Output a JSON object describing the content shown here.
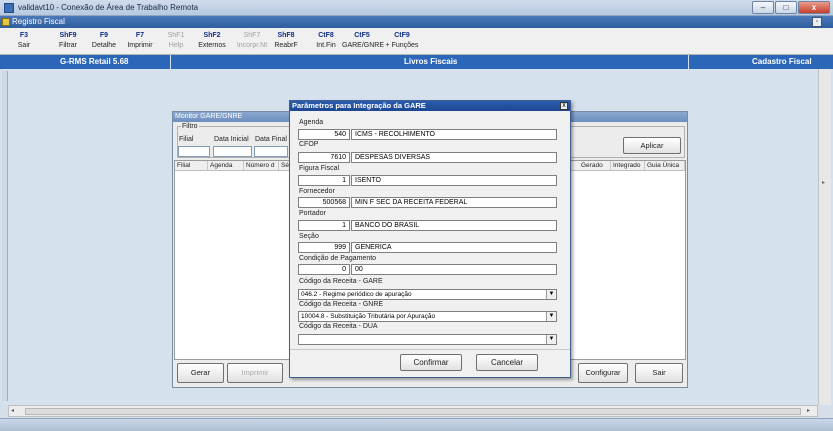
{
  "window": {
    "title": "validavt10 - Conexão de Área de Trabalho Remota"
  },
  "app": {
    "title": "Registro Fiscal"
  },
  "toolbar": [
    {
      "key": "F3",
      "label": "Sair",
      "enabled": true
    },
    {
      "key": "ShF9",
      "label": "Filtrar",
      "enabled": true
    },
    {
      "key": "F9",
      "label": "Detalhe",
      "enabled": true
    },
    {
      "key": "F7",
      "label": "Imprimir",
      "enabled": true
    },
    {
      "key": "ShF1",
      "label": "Help",
      "enabled": false
    },
    {
      "key": "ShF2",
      "label": "Externos",
      "enabled": true
    },
    {
      "key": "ShF7",
      "label": "Incorpr.Nt",
      "enabled": false
    },
    {
      "key": "ShF8",
      "label": "ReabrF",
      "enabled": true
    },
    {
      "key": "CtF8",
      "label": "Int.Fin",
      "enabled": true
    },
    {
      "key": "CtF5",
      "label": "GARE/GNRE",
      "enabled": true
    },
    {
      "key": "CtF9",
      "label": "+ Funções",
      "enabled": true
    }
  ],
  "bluebar": {
    "left": "G-RMS Retail 5.68",
    "center": "Livros Fiscais",
    "right": "Cadastro Fiscal"
  },
  "monitor": {
    "title": "Monitor GARE/GNRE",
    "filter_group": "Filtro",
    "filial_label": "Filial",
    "data_inicial_label": "Data Inicial",
    "data_final_label": "Data Final",
    "apply_button": "Aplicar",
    "columns_left": [
      "Filial",
      "Agenda",
      "Número d",
      "Sér"
    ],
    "columns_right": [
      "Gerado",
      "Integrado",
      "Guia Única"
    ],
    "buttons": {
      "gerar": "Gerar",
      "imprimir": "Imprimir",
      "configurar": "Configurar",
      "sair": "Sair"
    }
  },
  "dialog": {
    "title": "Parâmetros para Integração da GARE",
    "close": "x",
    "fields": {
      "agenda": {
        "label": "Agenda",
        "code": "540",
        "desc": "ICMS - RECOLHIMENTO"
      },
      "cfop": {
        "label": "CFOP",
        "code": "7610",
        "desc": "DESPESAS DIVERSAS"
      },
      "figura": {
        "label": "Figura Fiscal",
        "code": "1",
        "desc": "ISENTO"
      },
      "fornecedor": {
        "label": "Fornecedor",
        "code": "500568",
        "desc": "MIN F SEC DA RECEITA FEDERAL"
      },
      "portador": {
        "label": "Portador",
        "code": "1",
        "desc": "BANCO DO BRASIL"
      },
      "secao": {
        "label": "Seção",
        "code": "999",
        "desc": "GENERICA"
      },
      "condicao": {
        "label": "Condição de Pagamento",
        "code": "0",
        "desc": "00"
      }
    },
    "combos": {
      "gare": {
        "label": "Código da Receita - GARE",
        "value": "046.2 - Regime periódico de apuração"
      },
      "gnre": {
        "label": "Código da Receita - GNRE",
        "value": "10004.8 - Substituição Tributária por Apuração"
      },
      "dua": {
        "label": "Código da Receita - DUA",
        "value": ""
      }
    },
    "confirm_button": "Confirmar",
    "cancel_button": "Cancelar"
  },
  "colors": {
    "titlebar": "#2c66b8",
    "dialog_title": "#1c4690",
    "workspace": "#d6e1ee"
  }
}
